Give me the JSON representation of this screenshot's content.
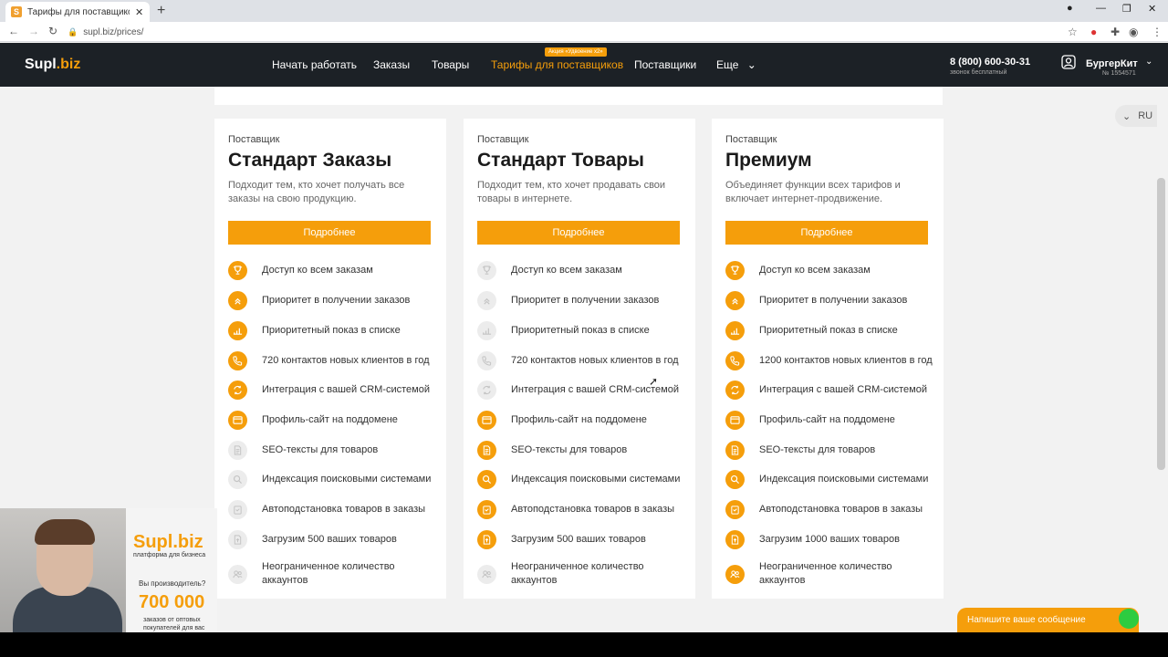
{
  "browser": {
    "tab_title": "Тарифы для поставщиков — Sup",
    "favicon_letter": "S",
    "url": "supl.biz/prices/"
  },
  "header": {
    "logo_main": "Supl",
    "logo_suffix": ".biz",
    "nav": [
      "Начать работать",
      "Заказы",
      "Товары",
      "Тарифы для поставщиков",
      "Поставщики",
      "Еще"
    ],
    "promo_badge": "Акция «Удвоение x2»",
    "phone": "8 (800) 600-30-31",
    "phone_note": "звонок бесплатный",
    "user_name": "БургерКит",
    "user_id": "№ 1554571"
  },
  "lang": "RU",
  "plans": [
    {
      "tag": "Поставщик",
      "title": "Стандарт Заказы",
      "desc": "Подходит тем, кто хочет получать все заказы на свою продукцию.",
      "button": "Подробнее",
      "features": [
        {
          "label": "Доступ ко всем заказам",
          "on": true,
          "icon": "trophy-icon"
        },
        {
          "label": "Приоритет в получении заказов",
          "on": true,
          "icon": "chevrons-up-icon"
        },
        {
          "label": "Приоритетный показ в списке",
          "on": true,
          "icon": "chart-icon"
        },
        {
          "label": "720 контактов новых клиентов в год",
          "on": true,
          "icon": "phone-icon"
        },
        {
          "label": "Интеграция с вашей CRM-системой",
          "on": true,
          "icon": "sync-icon"
        },
        {
          "label": "Профиль-сайт на поддомене",
          "on": true,
          "icon": "browser-icon"
        },
        {
          "label": "SEO-тексты для товаров",
          "on": false,
          "icon": "document-icon"
        },
        {
          "label": "Индексация поисковыми системами",
          "on": false,
          "icon": "search-icon"
        },
        {
          "label": "Автоподстановка товаров в заказы",
          "on": false,
          "icon": "clipboard-icon"
        },
        {
          "label": "Загрузим 500 ваших товаров",
          "on": false,
          "icon": "upload-icon"
        },
        {
          "label": "Неограниченное количество аккаунтов",
          "on": false,
          "icon": "users-icon"
        }
      ]
    },
    {
      "tag": "Поставщик",
      "title": "Стандарт Товары",
      "desc": "Подходит тем, кто хочет продавать свои товары в интернете.",
      "button": "Подробнее",
      "features": [
        {
          "label": "Доступ ко всем заказам",
          "on": false,
          "icon": "trophy-icon"
        },
        {
          "label": "Приоритет в получении заказов",
          "on": false,
          "icon": "chevrons-up-icon"
        },
        {
          "label": "Приоритетный показ в списке",
          "on": false,
          "icon": "chart-icon"
        },
        {
          "label": "720 контактов новых клиентов в год",
          "on": false,
          "icon": "phone-icon"
        },
        {
          "label": "Интеграция с вашей CRM-системой",
          "on": false,
          "icon": "sync-icon"
        },
        {
          "label": "Профиль-сайт на поддомене",
          "on": true,
          "icon": "browser-icon"
        },
        {
          "label": "SEO-тексты для товаров",
          "on": true,
          "icon": "document-icon"
        },
        {
          "label": "Индексация поисковыми системами",
          "on": true,
          "icon": "search-icon"
        },
        {
          "label": "Автоподстановка товаров в заказы",
          "on": true,
          "icon": "clipboard-icon"
        },
        {
          "label": "Загрузим 500 ваших товаров",
          "on": true,
          "icon": "upload-icon"
        },
        {
          "label": "Неограниченное количество аккаунтов",
          "on": false,
          "icon": "users-icon"
        }
      ]
    },
    {
      "tag": "Поставщик",
      "title": "Премиум",
      "desc": "Объединяет функции всех тарифов и включает интернет-продвижение.",
      "button": "Подробнее",
      "features": [
        {
          "label": "Доступ ко всем заказам",
          "on": true,
          "icon": "trophy-icon"
        },
        {
          "label": "Приоритет в получении заказов",
          "on": true,
          "icon": "chevrons-up-icon"
        },
        {
          "label": "Приоритетный показ в списке",
          "on": true,
          "icon": "chart-icon"
        },
        {
          "label": "1200 контактов новых клиентов в год",
          "on": true,
          "icon": "phone-icon"
        },
        {
          "label": "Интеграция с вашей CRM-системой",
          "on": true,
          "icon": "sync-icon"
        },
        {
          "label": "Профиль-сайт на поддомене",
          "on": true,
          "icon": "browser-icon"
        },
        {
          "label": "SEO-тексты для товаров",
          "on": true,
          "icon": "document-icon"
        },
        {
          "label": "Индексация поисковыми системами",
          "on": true,
          "icon": "search-icon"
        },
        {
          "label": "Автоподстановка товаров в заказы",
          "on": true,
          "icon": "clipboard-icon"
        },
        {
          "label": "Загрузим 1000 ваших товаров",
          "on": true,
          "icon": "upload-icon"
        },
        {
          "label": "Неограниченное количество аккаунтов",
          "on": true,
          "icon": "users-icon"
        }
      ]
    }
  ],
  "webcam": {
    "banner_logo": "Supl.biz",
    "banner_sub": "платформа для бизнеса",
    "banner_question": "Вы производитель?",
    "banner_number": "700 000",
    "banner_small": "заказов от оптовых покупателей для вас"
  },
  "chat": {
    "label": "Напишите ваше сообщение"
  },
  "colors": {
    "accent": "#f59e0b",
    "header_bg": "#1c2126",
    "page_bg": "#f2f2f2"
  }
}
